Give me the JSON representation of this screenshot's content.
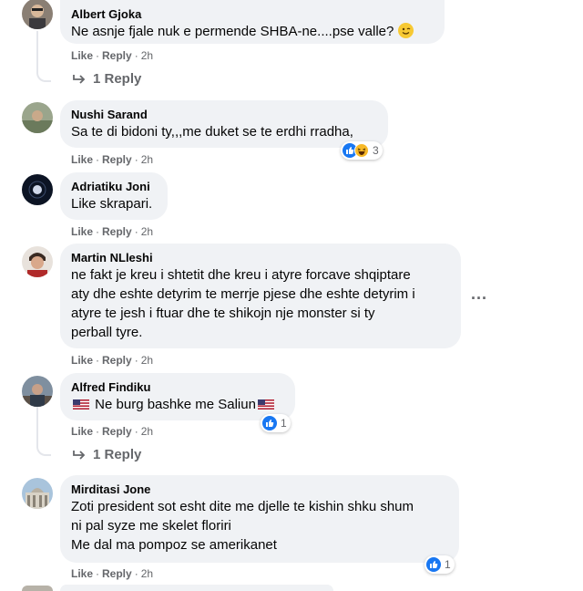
{
  "comments": [
    {
      "author": "Albert Gjoka",
      "text": "Ne asnje fjale nuk e permende SHBA-ne....pse valle?",
      "emoji": "smiling-face-emoji",
      "like": "Like",
      "reply": "Reply",
      "time": "2h",
      "replies_label": "1 Reply"
    },
    {
      "author": "Nushi Sarand",
      "text": "Sa te di bidoni ty,,,me duket se te erdhi rradha,",
      "like": "Like",
      "reply": "Reply",
      "time": "2h",
      "reactions": {
        "types": [
          "like-icon",
          "haha-icon"
        ],
        "count": "3"
      }
    },
    {
      "author": "Adriatiku Joni",
      "text": "Like skrapari.",
      "like": "Like",
      "reply": "Reply",
      "time": "2h"
    },
    {
      "author": "Martin NLleshi",
      "text": "ne fakt je kreu i shtetit dhe kreu i atyre forcave shqiptare\naty dhe eshte detyrim te merrje pjese dhe eshte detyrim i\natyre te jesh i ftuar dhe te shikojn nje monster si ty\nperball tyre.",
      "like": "Like",
      "reply": "Reply",
      "time": "2h",
      "more_label": "..."
    },
    {
      "author": "Alfred Findiku",
      "text": "Ne burg bashke me Saliun",
      "like": "Like",
      "reply": "Reply",
      "time": "2h",
      "reactions": {
        "types": [
          "like-icon"
        ],
        "count": "1"
      },
      "replies_label": "1 Reply"
    },
    {
      "author": "Mirditasi Jone",
      "text": "Zoti president sot esht dite me djelle te kishin shku shum\nni pal syze me skelet floriri\nMe dal ma pompoz se amerikanet",
      "like": "Like",
      "reply": "Reply",
      "time": "2h",
      "reactions": {
        "types": [
          "like-icon"
        ],
        "count": "1"
      }
    }
  ],
  "colors": {
    "bubble": "#f0f2f5",
    "meta": "#65676b",
    "like_blue": "#1877f2",
    "haha_yellow": "#f7b928"
  }
}
